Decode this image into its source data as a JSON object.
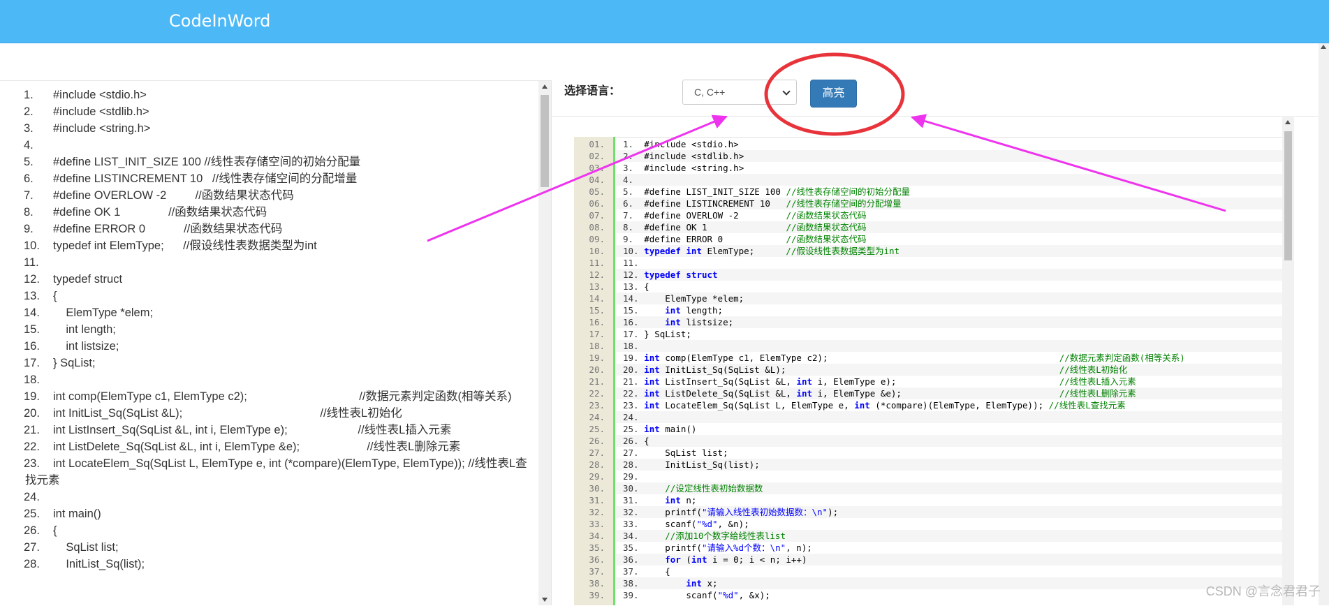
{
  "app": {
    "title": "CodeInWord"
  },
  "toolbar": {
    "lang_label": "选择语言：",
    "lang_value": "C, C++",
    "highlight_label": "高亮"
  },
  "watermark": "CSDN @言念君君子",
  "left_lines": [
    {
      "n": "1.",
      "t": "#include <stdio.h>"
    },
    {
      "n": "2.",
      "t": "#include <stdlib.h>"
    },
    {
      "n": "3.",
      "t": "#include <string.h>"
    },
    {
      "n": "4.",
      "t": ""
    },
    {
      "n": "5.",
      "t": "#define LIST_INIT_SIZE 100 //线性表存储空间的初始分配量"
    },
    {
      "n": "6.",
      "t": "#define LISTINCREMENT 10   //线性表存储空间的分配增量"
    },
    {
      "n": "7.",
      "t": "#define OVERLOW -2         //函数结果状态代码"
    },
    {
      "n": "8.",
      "t": "#define OK 1               //函数结果状态代码"
    },
    {
      "n": "9.",
      "t": "#define ERROR 0            //函数结果状态代码"
    },
    {
      "n": "10.",
      "t": "typedef int ElemType;      //假设线性表数据类型为int"
    },
    {
      "n": "11.",
      "t": ""
    },
    {
      "n": "12.",
      "t": "typedef struct"
    },
    {
      "n": "13.",
      "t": "{"
    },
    {
      "n": "14.",
      "t": "    ElemType *elem;"
    },
    {
      "n": "15.",
      "t": "    int length;"
    },
    {
      "n": "16.",
      "t": "    int listsize;"
    },
    {
      "n": "17.",
      "t": "} SqList;"
    },
    {
      "n": "18.",
      "t": ""
    },
    {
      "n": "19.",
      "t": "int comp(ElemType c1, ElemType c2);                                   //数据元素判定函数(相等关系)",
      "wrap": true
    },
    {
      "n": "20.",
      "t": "int InitList_Sq(SqList &L);                                           //线性表L初始化"
    },
    {
      "n": "21.",
      "t": "int ListInsert_Sq(SqList &L, int i, ElemType e);                      //线性表L插入元素"
    },
    {
      "n": "22.",
      "t": "int ListDelete_Sq(SqList &L, int i, ElemType &e);                     //线性表L删除元素",
      "wrap": true
    },
    {
      "n": "23.",
      "t": "int LocateElem_Sq(SqList L, ElemType e, int (*compare)(ElemType, ElemType)); //线性表L查找元素",
      "wrap": true
    },
    {
      "n": "24.",
      "t": ""
    },
    {
      "n": "25.",
      "t": "int main()"
    },
    {
      "n": "26.",
      "t": "{"
    },
    {
      "n": "27.",
      "t": "    SqList list;"
    },
    {
      "n": "28.",
      "t": "    InitList_Sq(list);"
    }
  ],
  "right_lines": [
    {
      "g": "01.",
      "n": "1.",
      "s": [
        [
          "pl",
          "#include <stdio.h>"
        ]
      ]
    },
    {
      "g": "02.",
      "n": "2.",
      "s": [
        [
          "pl",
          "#include <stdlib.h>"
        ]
      ]
    },
    {
      "g": "03.",
      "n": "3.",
      "s": [
        [
          "pl",
          "#include <string.h>"
        ]
      ]
    },
    {
      "g": "04.",
      "n": "4.",
      "s": []
    },
    {
      "g": "05.",
      "n": "5.",
      "s": [
        [
          "pl",
          "#define LIST_INIT_SIZE 100 "
        ],
        [
          "cm",
          "//线性表存储空间的初始分配量"
        ]
      ]
    },
    {
      "g": "06.",
      "n": "6.",
      "s": [
        [
          "pl",
          "#define LISTINCREMENT 10   "
        ],
        [
          "cm",
          "//线性表存储空间的分配增量"
        ]
      ]
    },
    {
      "g": "07.",
      "n": "7.",
      "s": [
        [
          "pl",
          "#define OVERLOW -2         "
        ],
        [
          "cm",
          "//函数结果状态代码"
        ]
      ]
    },
    {
      "g": "08.",
      "n": "8.",
      "s": [
        [
          "pl",
          "#define OK 1               "
        ],
        [
          "cm",
          "//函数结果状态代码"
        ]
      ]
    },
    {
      "g": "09.",
      "n": "9.",
      "s": [
        [
          "pl",
          "#define ERROR 0            "
        ],
        [
          "cm",
          "//函数结果状态代码"
        ]
      ]
    },
    {
      "g": "10.",
      "n": "10.",
      "s": [
        [
          "kw",
          "typedef"
        ],
        [
          "pl",
          " "
        ],
        [
          "kw",
          "int"
        ],
        [
          "pl",
          " ElemType;      "
        ],
        [
          "cm",
          "//假设线性表数据类型为int"
        ]
      ]
    },
    {
      "g": "11.",
      "n": "11.",
      "s": []
    },
    {
      "g": "12.",
      "n": "12.",
      "s": [
        [
          "kw",
          "typedef"
        ],
        [
          "pl",
          " "
        ],
        [
          "kw",
          "struct"
        ]
      ]
    },
    {
      "g": "13.",
      "n": "13.",
      "s": [
        [
          "pl",
          "{"
        ]
      ]
    },
    {
      "g": "14.",
      "n": "14.",
      "s": [
        [
          "pl",
          "    ElemType *elem;"
        ]
      ]
    },
    {
      "g": "15.",
      "n": "15.",
      "s": [
        [
          "pl",
          "    "
        ],
        [
          "kw",
          "int"
        ],
        [
          "pl",
          " length;"
        ]
      ]
    },
    {
      "g": "16.",
      "n": "16.",
      "s": [
        [
          "pl",
          "    "
        ],
        [
          "kw",
          "int"
        ],
        [
          "pl",
          " listsize;"
        ]
      ]
    },
    {
      "g": "17.",
      "n": "17.",
      "s": [
        [
          "pl",
          "} SqList;"
        ]
      ]
    },
    {
      "g": "18.",
      "n": "18.",
      "s": []
    },
    {
      "g": "19.",
      "n": "19.",
      "s": [
        [
          "kw",
          "int"
        ],
        [
          "pl",
          " comp(ElemType c1, ElemType c2);                                            "
        ],
        [
          "cm",
          "//数据元素判定函数(相等关系)"
        ]
      ]
    },
    {
      "g": "20.",
      "n": "20.",
      "s": [
        [
          "kw",
          "int"
        ],
        [
          "pl",
          " InitList_Sq(SqList &L);                                                    "
        ],
        [
          "cm",
          "//线性表L初始化"
        ]
      ]
    },
    {
      "g": "21.",
      "n": "21.",
      "s": [
        [
          "kw",
          "int"
        ],
        [
          "pl",
          " ListInsert_Sq(SqList &L, "
        ],
        [
          "kw",
          "int"
        ],
        [
          "pl",
          " i, ElemType e);                               "
        ],
        [
          "cm",
          "//线性表L插入元素"
        ]
      ]
    },
    {
      "g": "22.",
      "n": "22.",
      "s": [
        [
          "kw",
          "int"
        ],
        [
          "pl",
          " ListDelete_Sq(SqList &L, "
        ],
        [
          "kw",
          "int"
        ],
        [
          "pl",
          " i, ElemType &e);                              "
        ],
        [
          "cm",
          "//线性表L删除元素"
        ]
      ]
    },
    {
      "g": "23.",
      "n": "23.",
      "s": [
        [
          "kw",
          "int"
        ],
        [
          "pl",
          " LocateElem_Sq(SqList L, ElemType e, "
        ],
        [
          "kw",
          "int"
        ],
        [
          "pl",
          " (*compare)(ElemType, ElemType)); "
        ],
        [
          "cm",
          "//线性表L查找元素"
        ]
      ]
    },
    {
      "g": "24.",
      "n": "24.",
      "s": []
    },
    {
      "g": "25.",
      "n": "25.",
      "s": [
        [
          "kw",
          "int"
        ],
        [
          "pl",
          " main()"
        ]
      ]
    },
    {
      "g": "26.",
      "n": "26.",
      "s": [
        [
          "pl",
          "{"
        ]
      ]
    },
    {
      "g": "27.",
      "n": "27.",
      "s": [
        [
          "pl",
          "    SqList list;"
        ]
      ]
    },
    {
      "g": "28.",
      "n": "28.",
      "s": [
        [
          "pl",
          "    InitList_Sq(list);"
        ]
      ]
    },
    {
      "g": "29.",
      "n": "29.",
      "s": []
    },
    {
      "g": "30.",
      "n": "30.",
      "s": [
        [
          "pl",
          "    "
        ],
        [
          "cm",
          "//设定线性表初始数据数"
        ]
      ]
    },
    {
      "g": "31.",
      "n": "31.",
      "s": [
        [
          "pl",
          "    "
        ],
        [
          "kw",
          "int"
        ],
        [
          "pl",
          " n;"
        ]
      ]
    },
    {
      "g": "32.",
      "n": "32.",
      "s": [
        [
          "pl",
          "    printf("
        ],
        [
          "st",
          "\"请输入线性表初始数据数：\\n\""
        ],
        [
          "pl",
          ");"
        ]
      ]
    },
    {
      "g": "33.",
      "n": "33.",
      "s": [
        [
          "pl",
          "    scanf("
        ],
        [
          "st",
          "\"%d\""
        ],
        [
          "pl",
          ", &n);"
        ]
      ]
    },
    {
      "g": "34.",
      "n": "34.",
      "s": [
        [
          "pl",
          "    "
        ],
        [
          "cm",
          "//添加10个数字给线性表list"
        ]
      ]
    },
    {
      "g": "35.",
      "n": "35.",
      "s": [
        [
          "pl",
          "    printf("
        ],
        [
          "st",
          "\"请输入%d个数：\\n\""
        ],
        [
          "pl",
          ", n);"
        ]
      ]
    },
    {
      "g": "36.",
      "n": "36.",
      "s": [
        [
          "pl",
          "    "
        ],
        [
          "kw",
          "for"
        ],
        [
          "pl",
          " ("
        ],
        [
          "kw",
          "int"
        ],
        [
          "pl",
          " i = 0; i < n; i++)"
        ]
      ]
    },
    {
      "g": "37.",
      "n": "37.",
      "s": [
        [
          "pl",
          "    {"
        ]
      ]
    },
    {
      "g": "38.",
      "n": "38.",
      "s": [
        [
          "pl",
          "        "
        ],
        [
          "kw",
          "int"
        ],
        [
          "pl",
          " x;"
        ]
      ]
    },
    {
      "g": "39.",
      "n": "39.",
      "s": [
        [
          "pl",
          "        scanf("
        ],
        [
          "st",
          "\"%d\""
        ],
        [
          "pl",
          ", &x);"
        ]
      ]
    }
  ],
  "colors": {
    "navbar": "#4db8f6",
    "button": "#337ab7",
    "keyword": "#0000ff",
    "comment": "#008200",
    "gutter": "#ece9d8",
    "gutter_border": "#6ce26c",
    "annotation_circle": "#e8333a",
    "annotation_arrow": "#ee33ee"
  }
}
